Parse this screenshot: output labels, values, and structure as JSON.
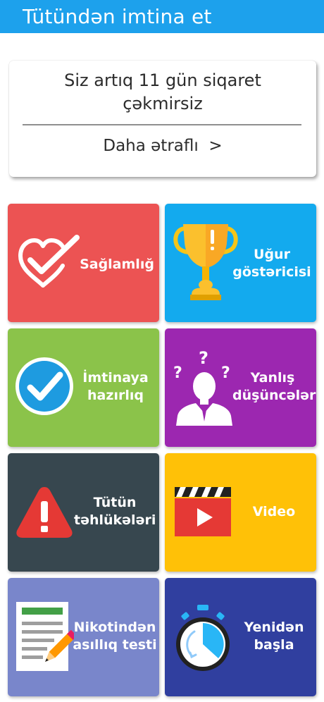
{
  "header": {
    "title": "Tütündən imtina et",
    "color": "#1da1ec"
  },
  "status_card": {
    "message": "Siz artıq 11 gün siqaret çəkmirsiz",
    "more_link": "Daha ətraflı  >"
  },
  "tiles": [
    {
      "label": "Sağlamlığ",
      "color": "#ec5353",
      "icon": "heart-check-icon"
    },
    {
      "label": "Uğur göstəricisi",
      "color": "#13aaee",
      "icon": "trophy-icon"
    },
    {
      "label": "İmtinaya hazırlıq",
      "color": "#8bc34a",
      "icon": "check-circle-icon"
    },
    {
      "label": "Yanlış düşüncələr",
      "color": "#9c27b0",
      "icon": "confused-person-icon"
    },
    {
      "label": "Tütün təhlükələri",
      "color": "#37474f",
      "icon": "warning-icon"
    },
    {
      "label": "Video",
      "color": "#ffc107",
      "icon": "video-clapper-icon"
    },
    {
      "label": "Nikotindən asıllıq testi",
      "color": "#7986cb",
      "icon": "test-document-icon"
    },
    {
      "label": "Yenidən başla",
      "color": "#303f9f",
      "icon": "stopwatch-icon"
    }
  ]
}
